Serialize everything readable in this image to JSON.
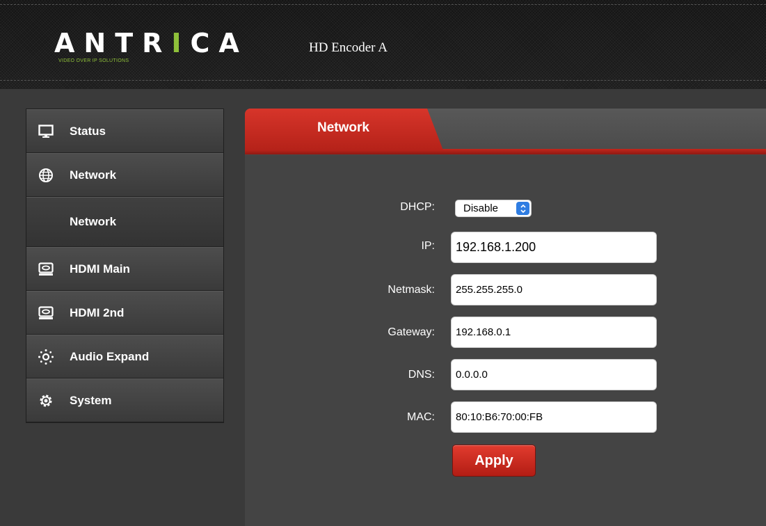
{
  "header": {
    "logo_text_a": "ANTR",
    "logo_text_b": "I",
    "logo_text_c": "CA",
    "logo_tagline": "VIDEO OVER IP SOLUTIONS",
    "device_title": "HD Encoder  A"
  },
  "sidebar": {
    "items": [
      {
        "label": "Status",
        "icon": "monitor-icon"
      },
      {
        "label": "Network",
        "icon": "globe-icon"
      },
      {
        "label": "Network",
        "icon": ""
      },
      {
        "label": "HDMI Main",
        "icon": "hdmi-icon"
      },
      {
        "label": "HDMI 2nd",
        "icon": "hdmi-icon"
      },
      {
        "label": "Audio Expand",
        "icon": "audio-icon"
      },
      {
        "label": "System",
        "icon": "gear-icon"
      }
    ]
  },
  "main": {
    "tab_label": "Network",
    "form": {
      "dhcp_label": "DHCP:",
      "dhcp_value": "Disable",
      "ip_label": "IP:",
      "ip_value": "192.168.1.200",
      "netmask_label": "Netmask:",
      "netmask_value": "255.255.255.0",
      "gateway_label": "Gateway:",
      "gateway_value": "192.168.0.1",
      "dns_label": "DNS:",
      "dns_value": "0.0.0.0",
      "mac_label": "MAC:",
      "mac_value": "80:10:B6:70:00:FB"
    },
    "apply_label": "Apply"
  },
  "colors": {
    "accent_red": "#c3261c",
    "logo_green": "#8fc03a",
    "select_blue": "#2f7de2"
  }
}
